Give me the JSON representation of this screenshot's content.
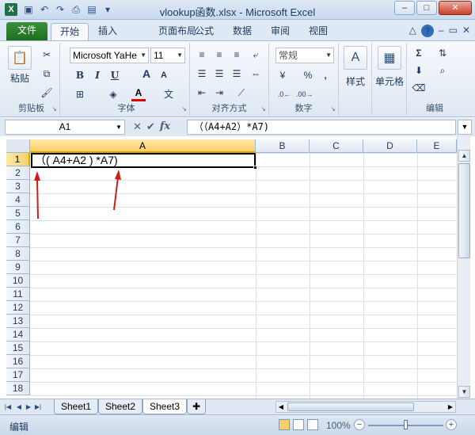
{
  "window": {
    "title": "vlookup函数.xlsx - Microsoft Excel",
    "app_icon": "X",
    "controls": [
      "–",
      "□",
      "✕"
    ]
  },
  "ribbon_tabs": [
    "文件",
    "开始",
    "插入",
    "页面布局",
    "公式",
    "数据",
    "审阅",
    "视图"
  ],
  "ribbon": {
    "clipboard": {
      "paste": "粘贴",
      "label": "剪贴板"
    },
    "font": {
      "name": "Microsoft YaHe",
      "size": "11",
      "bold": "B",
      "italic": "I",
      "underline": "U",
      "grow": "A",
      "shrink": "A",
      "color": "A",
      "label": "字体"
    },
    "alignment": {
      "label": "对齐方式"
    },
    "number": {
      "format": "常规",
      "percent": "%",
      "comma": ",",
      "label": "数字"
    },
    "styles": {
      "label": "样式"
    },
    "cells": {
      "label": "单元格"
    },
    "editing": {
      "sum": "Σ",
      "label": "编辑"
    }
  },
  "formula_bar": {
    "name_box": "A1",
    "fx": "fx",
    "content": "（（A4+A2）*A7)"
  },
  "grid": {
    "columns": [
      "A",
      "B",
      "C",
      "D",
      "E"
    ],
    "rows": [
      "1",
      "2",
      "3",
      "4",
      "5",
      "6",
      "7",
      "8",
      "9",
      "10",
      "11",
      "12",
      "13",
      "14",
      "15",
      "16",
      "17",
      "18"
    ],
    "active_cell": "A1",
    "a1_value": "（( A4+A2 ) *A7)"
  },
  "sheets": [
    "Sheet1",
    "Sheet2",
    "Sheet3"
  ],
  "active_sheet": "Sheet3",
  "status": {
    "mode": "编辑",
    "zoom": "100%"
  },
  "colors": {
    "accent_green": "#1e7145",
    "annotation_red": "#d01b1b",
    "selection_yellow": "#f8d06a"
  }
}
